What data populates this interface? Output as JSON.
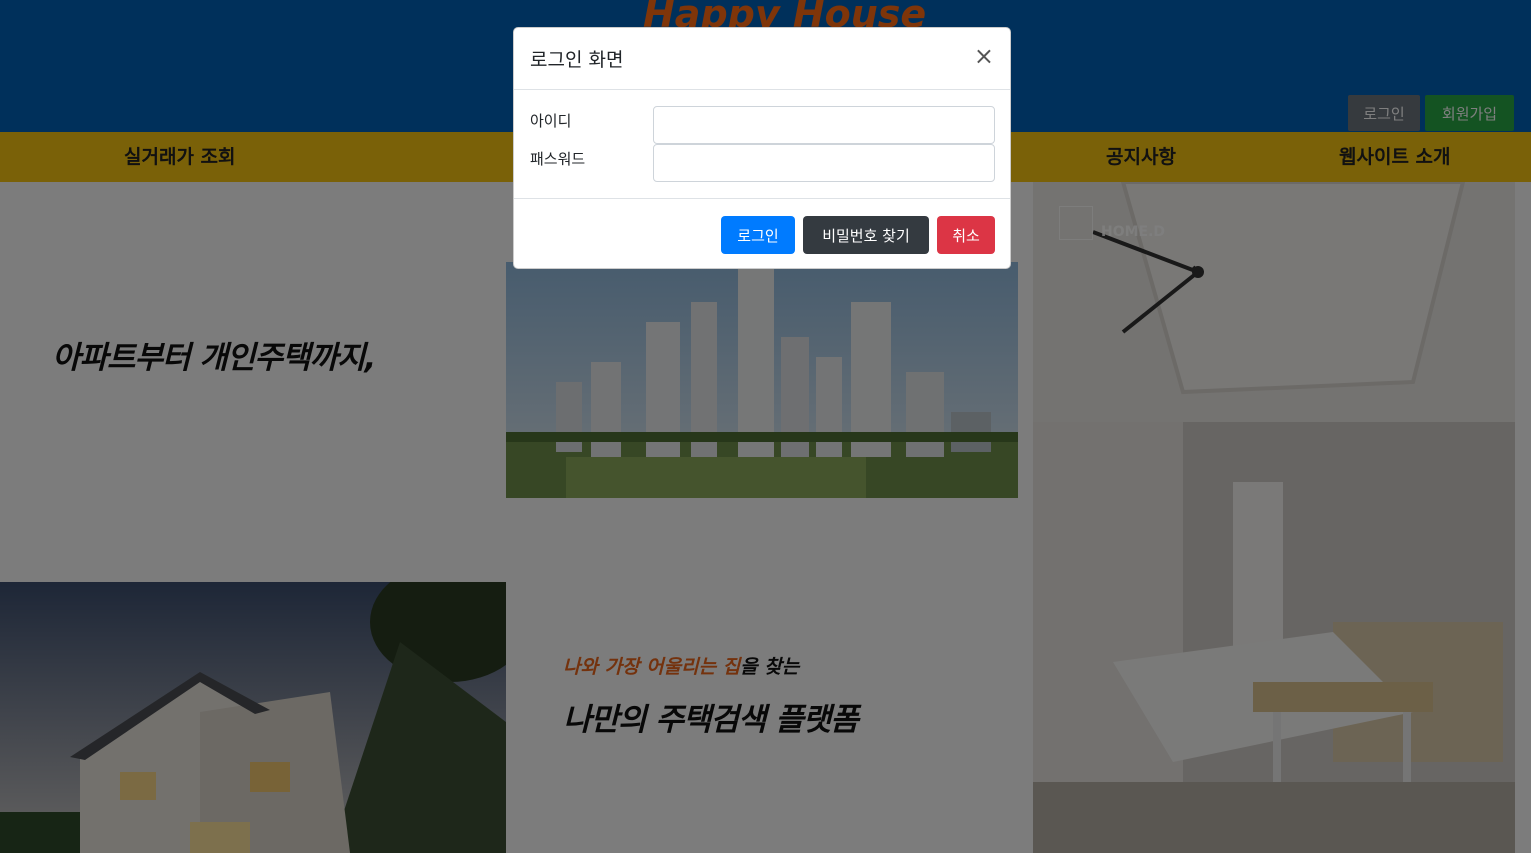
{
  "header": {
    "brand": "Happy House",
    "login_label": "로그인",
    "signup_label": "회원가입"
  },
  "nav": {
    "items": [
      {
        "label": "실거래가 조회"
      },
      {
        "label": "공지사항"
      },
      {
        "label": "웹사이트 소개"
      }
    ]
  },
  "hero": {
    "tagline": "아파트부터 개인주택까지,",
    "slogan_accent": "나와 가장 어울리는 집",
    "slogan_rest": "을 찾는",
    "slogan_main": "나만의 주택검색 플랫폼",
    "room_logo_text": "HOME.D"
  },
  "modal": {
    "title": "로그인 화면",
    "close_symbol": "×",
    "id_label": "아이디",
    "pw_label": "패스워드",
    "id_value": "",
    "pw_value": "",
    "login_button": "로그인",
    "find_pw_button": "비밀번호 찾기",
    "cancel_button": "취소"
  },
  "colors": {
    "header_bg": "#0060b6",
    "nav_bg": "#f5c211",
    "brand": "#ff6a13",
    "primary": "#007bff",
    "dark": "#343a40",
    "danger": "#dc3545",
    "secondary": "#6c757d",
    "success": "#28a745"
  }
}
